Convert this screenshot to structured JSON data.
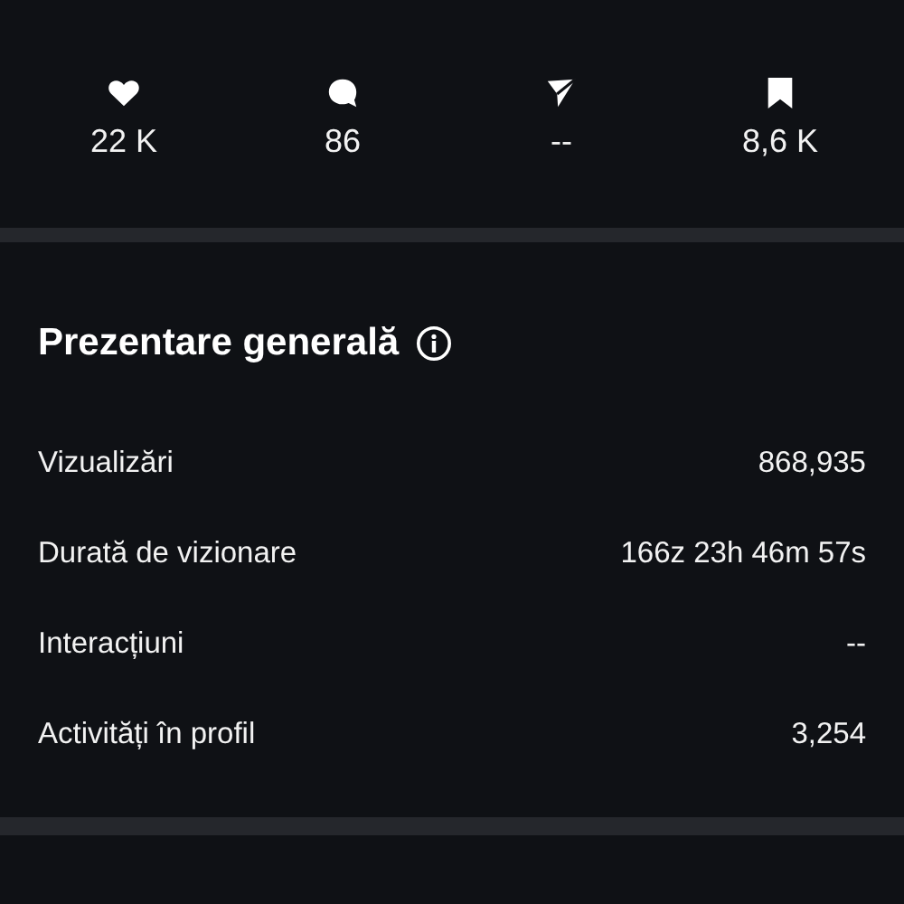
{
  "stats": [
    {
      "kind": "heart",
      "value": "22 K"
    },
    {
      "kind": "comment",
      "value": "86"
    },
    {
      "kind": "share",
      "value": "--"
    },
    {
      "kind": "bookmark",
      "value": "8,6 K"
    }
  ],
  "overview": {
    "title": "Prezentare generală",
    "rows": [
      {
        "label": "Vizualizări",
        "value": "868,935"
      },
      {
        "label": "Durată de vizionare",
        "value": "166z 23h 46m 57s"
      },
      {
        "label": "Interacțiuni",
        "value": "--"
      },
      {
        "label": "Activități în profil",
        "value": "3,254"
      }
    ]
  }
}
